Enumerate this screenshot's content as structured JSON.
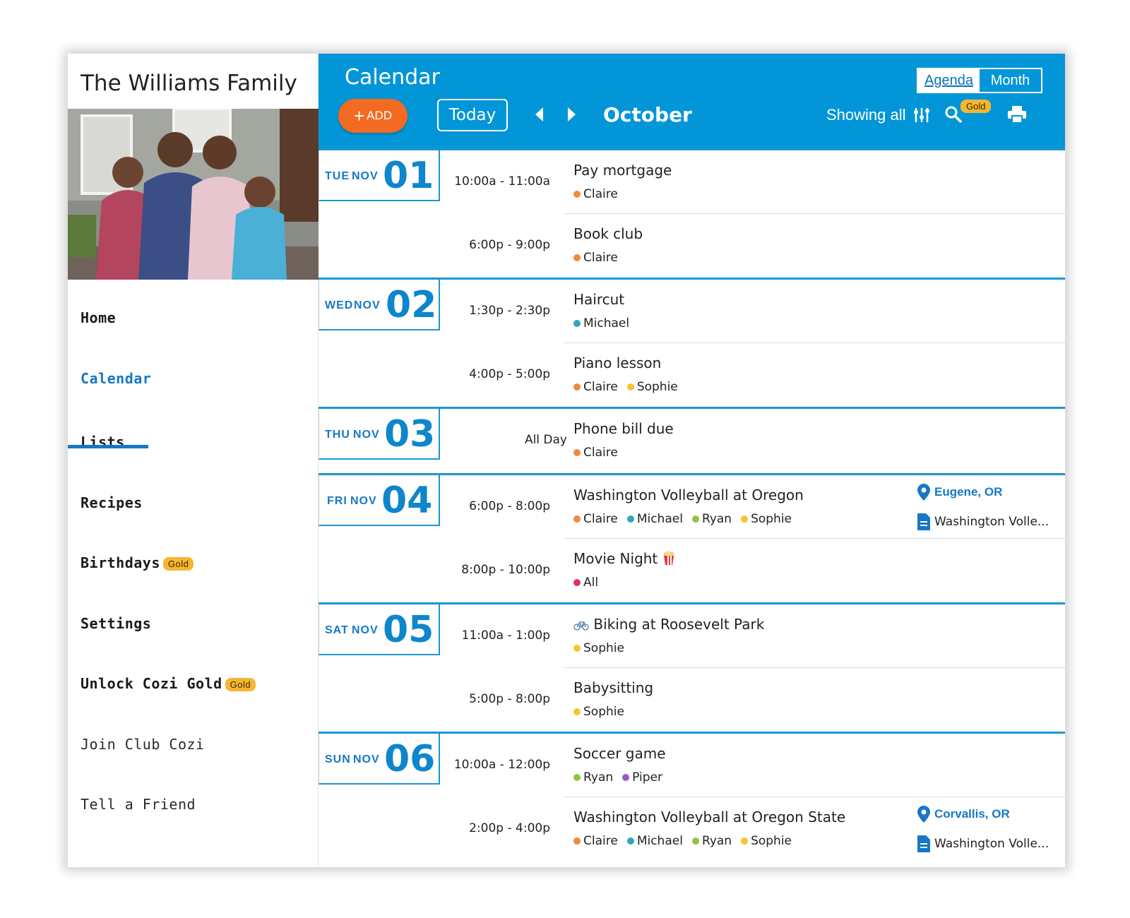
{
  "sidebar": {
    "family_name": "The Williams Family",
    "nav": [
      {
        "label": "Home",
        "gold": ""
      },
      {
        "label": "Calendar",
        "gold": ""
      },
      {
        "label": "Lists",
        "gold": ""
      },
      {
        "label": "Recipes",
        "gold": ""
      },
      {
        "label": "Birthdays",
        "gold": "Gold"
      },
      {
        "label": "Settings",
        "gold": ""
      },
      {
        "label": "Unlock Cozi Gold",
        "gold": "Gold"
      },
      {
        "label": "Join Club Cozi",
        "gold": ""
      },
      {
        "label": "Tell a Friend",
        "gold": ""
      }
    ],
    "active": "Calendar"
  },
  "header": {
    "title": "Calendar",
    "views": [
      "Agenda",
      "Month"
    ],
    "selected_view": "Agenda",
    "add_label": "ADD",
    "today_label": "Today",
    "month": "October",
    "showing_label": "Showing all",
    "gold_badge": "Gold",
    "icons": [
      "plus-icon",
      "chevron-left-icon",
      "chevron-right-icon",
      "filter-sliders-icon",
      "search-icon",
      "print-icon"
    ]
  },
  "colors": {
    "header_blue": "#0296d8",
    "accent_blue": "#1677c6",
    "add_orange": "#f26b21",
    "gold": "#f5b631",
    "claire": "#f0893a",
    "michael": "#2fa7b8",
    "ryan": "#8cc63f",
    "sophie": "#f5c431",
    "piper": "#9b59c6",
    "all": "#e0335f"
  },
  "days": [
    {
      "dow": "TUE",
      "mon": "NOV",
      "num": "01",
      "events": [
        {
          "time": "10:00a - 11:00a",
          "title": "Pay mortgage",
          "people": [
            "Claire"
          ]
        },
        {
          "time": "6:00p - 9:00p",
          "title": "Book club",
          "people": [
            "Claire"
          ]
        }
      ]
    },
    {
      "dow": "WED",
      "mon": "NOV",
      "num": "02",
      "events": [
        {
          "time": "1:30p - 2:30p",
          "title": "Haircut",
          "people": [
            "Michael"
          ]
        },
        {
          "time": "4:00p - 5:00p",
          "title": "Piano lesson",
          "people": [
            "Claire",
            "Sophie"
          ]
        }
      ]
    },
    {
      "dow": "THU",
      "mon": "NOV",
      "num": "03",
      "events": [
        {
          "time": "All Day",
          "title": "Phone bill due",
          "people": [
            "Claire"
          ]
        }
      ]
    },
    {
      "dow": "FRI",
      "mon": "NOV",
      "num": "04",
      "events": [
        {
          "time": "6:00p - 8:00p",
          "title": "Washington Volleyball at Oregon",
          "people": [
            "Claire",
            "Michael",
            "Ryan",
            "Sophie"
          ],
          "location": "Eugene, OR",
          "attachment": "Washington Volle..."
        },
        {
          "time": "8:00p - 10:00p",
          "title": "Movie Night",
          "icon": "popcorn-icon",
          "people": [
            "All"
          ]
        }
      ]
    },
    {
      "dow": "SAT",
      "mon": "NOV",
      "num": "05",
      "events": [
        {
          "time": "11:00a - 1:00p",
          "title": "Biking at Roosevelt Park",
          "icon": "bicycle-icon",
          "people": [
            "Sophie"
          ]
        },
        {
          "time": "5:00p - 8:00p",
          "title": "Babysitting",
          "people": [
            "Sophie"
          ]
        }
      ]
    },
    {
      "dow": "SUN",
      "mon": "NOV",
      "num": "06",
      "events": [
        {
          "time": "10:00a - 12:00p",
          "title": "Soccer game",
          "people": [
            "Ryan",
            "Piper"
          ]
        },
        {
          "time": "2:00p - 4:00p",
          "title": "Washington Volleyball at Oregon State",
          "people": [
            "Claire",
            "Michael",
            "Ryan",
            "Sophie"
          ],
          "location": "Corvallis, OR",
          "attachment": "Washington Volle..."
        }
      ]
    }
  ]
}
